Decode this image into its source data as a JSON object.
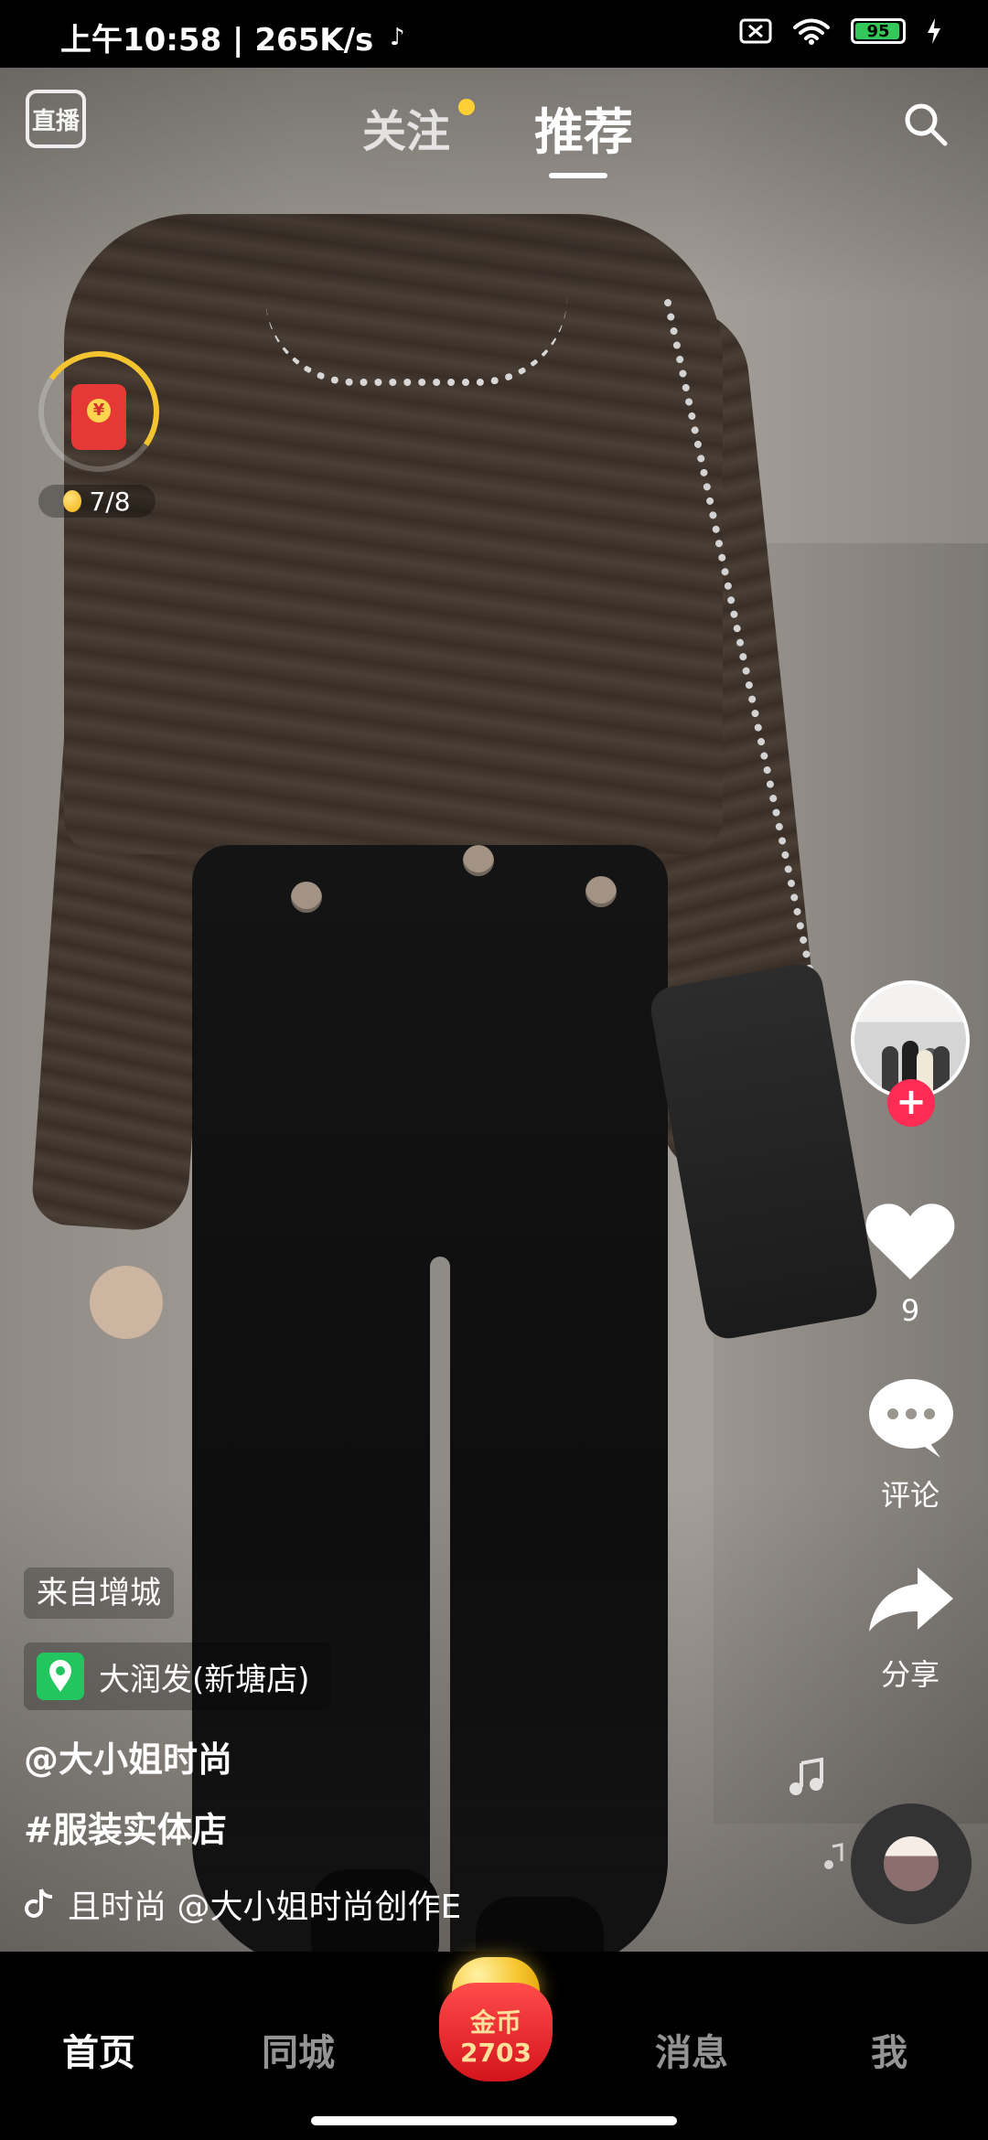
{
  "status_bar": {
    "left_text": "上午10:58 | 265K/s",
    "battery_level": "95",
    "battery_percent": 95
  },
  "top_nav": {
    "live_label": "直播",
    "follow_tab": "关注",
    "recommend_tab": "推荐",
    "search_icon": "search-icon"
  },
  "red_packet": {
    "progress_text": "7/8"
  },
  "actions": {
    "like_count": "9",
    "comment_label": "评论",
    "share_label": "分享"
  },
  "post": {
    "origin_tag": "来自增城",
    "location_name": "大润发(新塘店)",
    "author": "@大小姐时尚",
    "hashtag": "#服装实体店",
    "music_text": "且时尚 @大小姐时尚创作E"
  },
  "bottom_nav": {
    "home": "首页",
    "city": "同城",
    "coin_label": "金币",
    "coin_count": "2703",
    "messages": "消息",
    "me": "我"
  },
  "colors": {
    "accent_red": "#fe2c55",
    "gold": "#f4c430",
    "location_green": "#22c55e"
  }
}
